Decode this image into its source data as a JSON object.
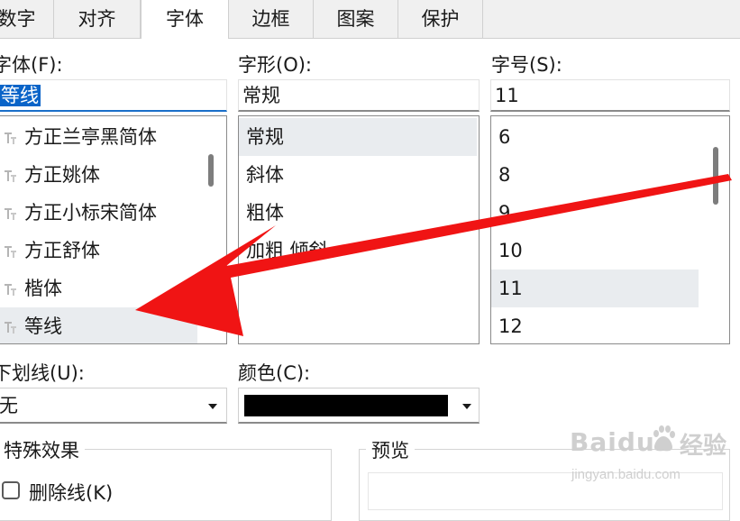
{
  "tabs": [
    {
      "label": "数字",
      "active": false
    },
    {
      "label": "对齐",
      "active": false
    },
    {
      "label": "字体",
      "active": true
    },
    {
      "label": "边框",
      "active": false
    },
    {
      "label": "图案",
      "active": false
    },
    {
      "label": "保护",
      "active": false
    }
  ],
  "font": {
    "label": "字体(F):",
    "value": "等线",
    "items": [
      "方正兰亭黑简体",
      "方正姚体",
      "方正小标宋简体",
      "方正舒体",
      "楷体",
      "等线"
    ],
    "selected": "等线"
  },
  "style": {
    "label": "字形(O):",
    "value": "常规",
    "items": [
      "常规",
      "斜体",
      "粗体",
      "加粗 倾斜"
    ],
    "selected": "常规"
  },
  "size": {
    "label": "字号(S):",
    "value": "11",
    "items": [
      "6",
      "8",
      "9",
      "10",
      "11",
      "12"
    ],
    "selected": "11"
  },
  "underline": {
    "label": "下划线(U):",
    "value": "无"
  },
  "color": {
    "label": "颜色(C):",
    "value": "#000000"
  },
  "effects": {
    "title": "特殊效果",
    "strikethrough_label": "删除线(K)"
  },
  "preview": {
    "title": "预览"
  },
  "watermark": {
    "brand": "Baidu",
    "brand_cn": "经验",
    "url": "jingyan.baidu.com"
  },
  "colors": {
    "arrow": "#f01414",
    "accent": "#0a64c8"
  }
}
